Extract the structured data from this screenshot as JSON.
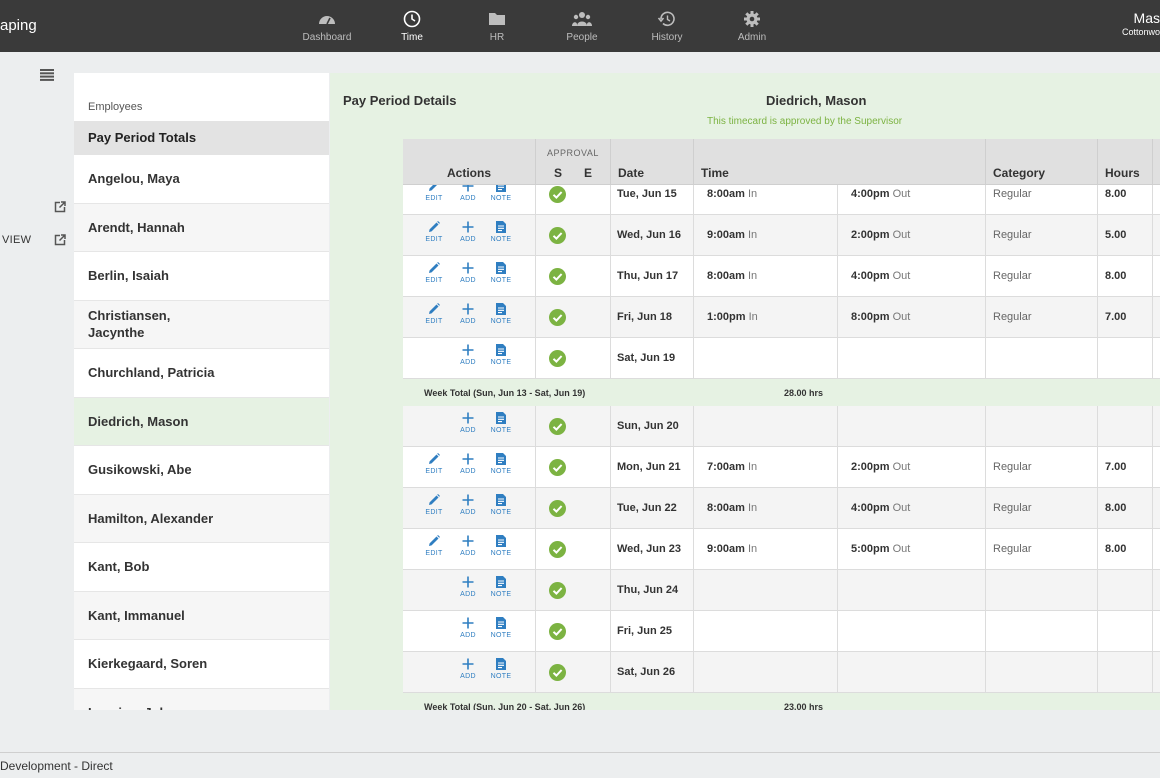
{
  "app": {
    "brand": "aping"
  },
  "nav": [
    {
      "label": "Dashboard",
      "icon": "dashboard-icon"
    },
    {
      "label": "Time",
      "icon": "clock-icon",
      "active": true
    },
    {
      "label": "HR",
      "icon": "folder-icon"
    },
    {
      "label": "People",
      "icon": "people-icon"
    },
    {
      "label": "History",
      "icon": "history-icon"
    },
    {
      "label": "Admin",
      "icon": "gear-icon"
    }
  ],
  "user": {
    "name": "Mas",
    "org": "Cottonwo"
  },
  "sidebar": {
    "view_label": "VIEW"
  },
  "employees": {
    "header": "Employees",
    "totals": "Pay Period Totals",
    "list": [
      "Angelou, Maya",
      "Arendt, Hannah",
      "Berlin, Isaiah",
      "Christiansen,\nJacynthe",
      "Churchland, Patricia",
      "Diedrich, Mason",
      "Gusikowski, Abe",
      "Hamilton, Alexander",
      "Kant, Bob",
      "Kant, Immanuel",
      "Kierkegaard, Soren",
      "Lacnian, John"
    ],
    "selected": "Diedrich, Mason"
  },
  "details": {
    "title": "Pay Period Details",
    "employee": "Diedrich, Mason",
    "approval_message": "This timecard is approved by the Supervisor"
  },
  "table": {
    "headers": {
      "actions": "Actions",
      "approval": "APPROVAL",
      "s": "S",
      "e": "E",
      "date": "Date",
      "time": "Time",
      "category": "Category",
      "hours": "Hours"
    },
    "action_labels": {
      "edit": "EDIT",
      "add": "ADD",
      "note": "NOTE"
    },
    "in_label": "In",
    "out_label": "Out",
    "rows": [
      {
        "kind": "day",
        "date": "Tue, Jun 15",
        "in": "8:00am",
        "out": "4:00pm",
        "category": "Regular",
        "hours": "8.00",
        "edit": true
      },
      {
        "kind": "day",
        "date": "Wed, Jun 16",
        "in": "9:00am",
        "out": "2:00pm",
        "category": "Regular",
        "hours": "5.00",
        "edit": true
      },
      {
        "kind": "day",
        "date": "Thu, Jun 17",
        "in": "8:00am",
        "out": "4:00pm",
        "category": "Regular",
        "hours": "8.00",
        "edit": true
      },
      {
        "kind": "day",
        "date": "Fri, Jun 18",
        "in": "1:00pm",
        "out": "8:00pm",
        "category": "Regular",
        "hours": "7.00",
        "edit": true
      },
      {
        "kind": "day",
        "date": "Sat, Jun 19",
        "edit": false
      },
      {
        "kind": "total",
        "label": "Week Total (Sun, Jun 13 - Sat, Jun 19)",
        "hours": "28.00 hrs"
      },
      {
        "kind": "day",
        "date": "Sun, Jun 20",
        "edit": false
      },
      {
        "kind": "day",
        "date": "Mon, Jun 21",
        "in": "7:00am",
        "out": "2:00pm",
        "category": "Regular",
        "hours": "7.00",
        "edit": true
      },
      {
        "kind": "day",
        "date": "Tue, Jun 22",
        "in": "8:00am",
        "out": "4:00pm",
        "category": "Regular",
        "hours": "8.00",
        "edit": true
      },
      {
        "kind": "day",
        "date": "Wed, Jun 23",
        "in": "9:00am",
        "out": "5:00pm",
        "category": "Regular",
        "hours": "8.00",
        "edit": true
      },
      {
        "kind": "day",
        "date": "Thu, Jun 24",
        "edit": false
      },
      {
        "kind": "day",
        "date": "Fri, Jun 25",
        "edit": false
      },
      {
        "kind": "day",
        "date": "Sat, Jun 26",
        "edit": false
      },
      {
        "kind": "total",
        "label": "Week Total (Sun, Jun 20 - Sat, Jun 26)",
        "hours": "23.00 hrs"
      }
    ]
  },
  "footer": {
    "text": "Development - Direct"
  },
  "colors": {
    "topbar": "#3a3a3a",
    "accent_blue": "#2f7ec1",
    "approved_green": "#7cb342",
    "selected_bg": "#e6f2e3"
  }
}
